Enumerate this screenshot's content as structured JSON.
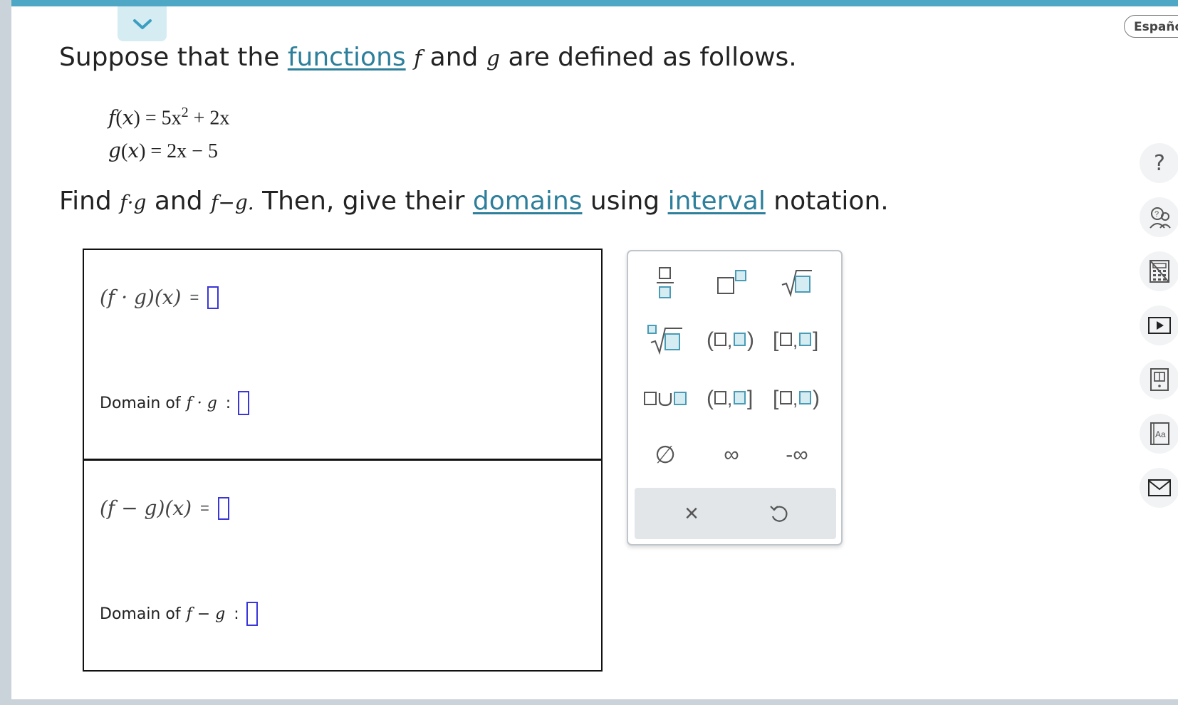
{
  "language_button": {
    "label": "Españo"
  },
  "collapse_icon": "chevron-down-icon",
  "problem": {
    "intro_a": "Suppose that the ",
    "link_functions": "functions",
    "f": "f",
    "and": " and ",
    "g": "g",
    "intro_b": " are defined as follows.",
    "f_def_lhs": "f",
    "f_def_rhs": "= 5x",
    "f_def_exp": "2",
    "f_def_tail": "+ 2x",
    "g_def_lhs": "g",
    "g_def_rhs": "= 2x − 5",
    "find": "Find ",
    "fg": "f·g",
    "f_minus_g": "f−g.",
    "then": " Then, give their ",
    "link_domains": "domains",
    "using": " using ",
    "link_interval": "interval",
    "notation": " notation."
  },
  "answers": {
    "product_expr": "(f · g)(x)",
    "product_eq": "=",
    "domain_prefix": "Domain of ",
    "product_name": "f · g",
    "colon": ":",
    "difference_expr": "(f − g)(x)",
    "difference_eq": "=",
    "difference_name": "f − g"
  },
  "palette": {
    "union": "∪",
    "empty_set": "∅",
    "infinity": "∞",
    "neg_infinity": "-∞",
    "clear": "×"
  },
  "colors": {
    "accent": "#4ea7c4",
    "link": "#2d7f9b",
    "answer_slot": "#3a36d8",
    "palette_box": "#4a9bb6"
  }
}
